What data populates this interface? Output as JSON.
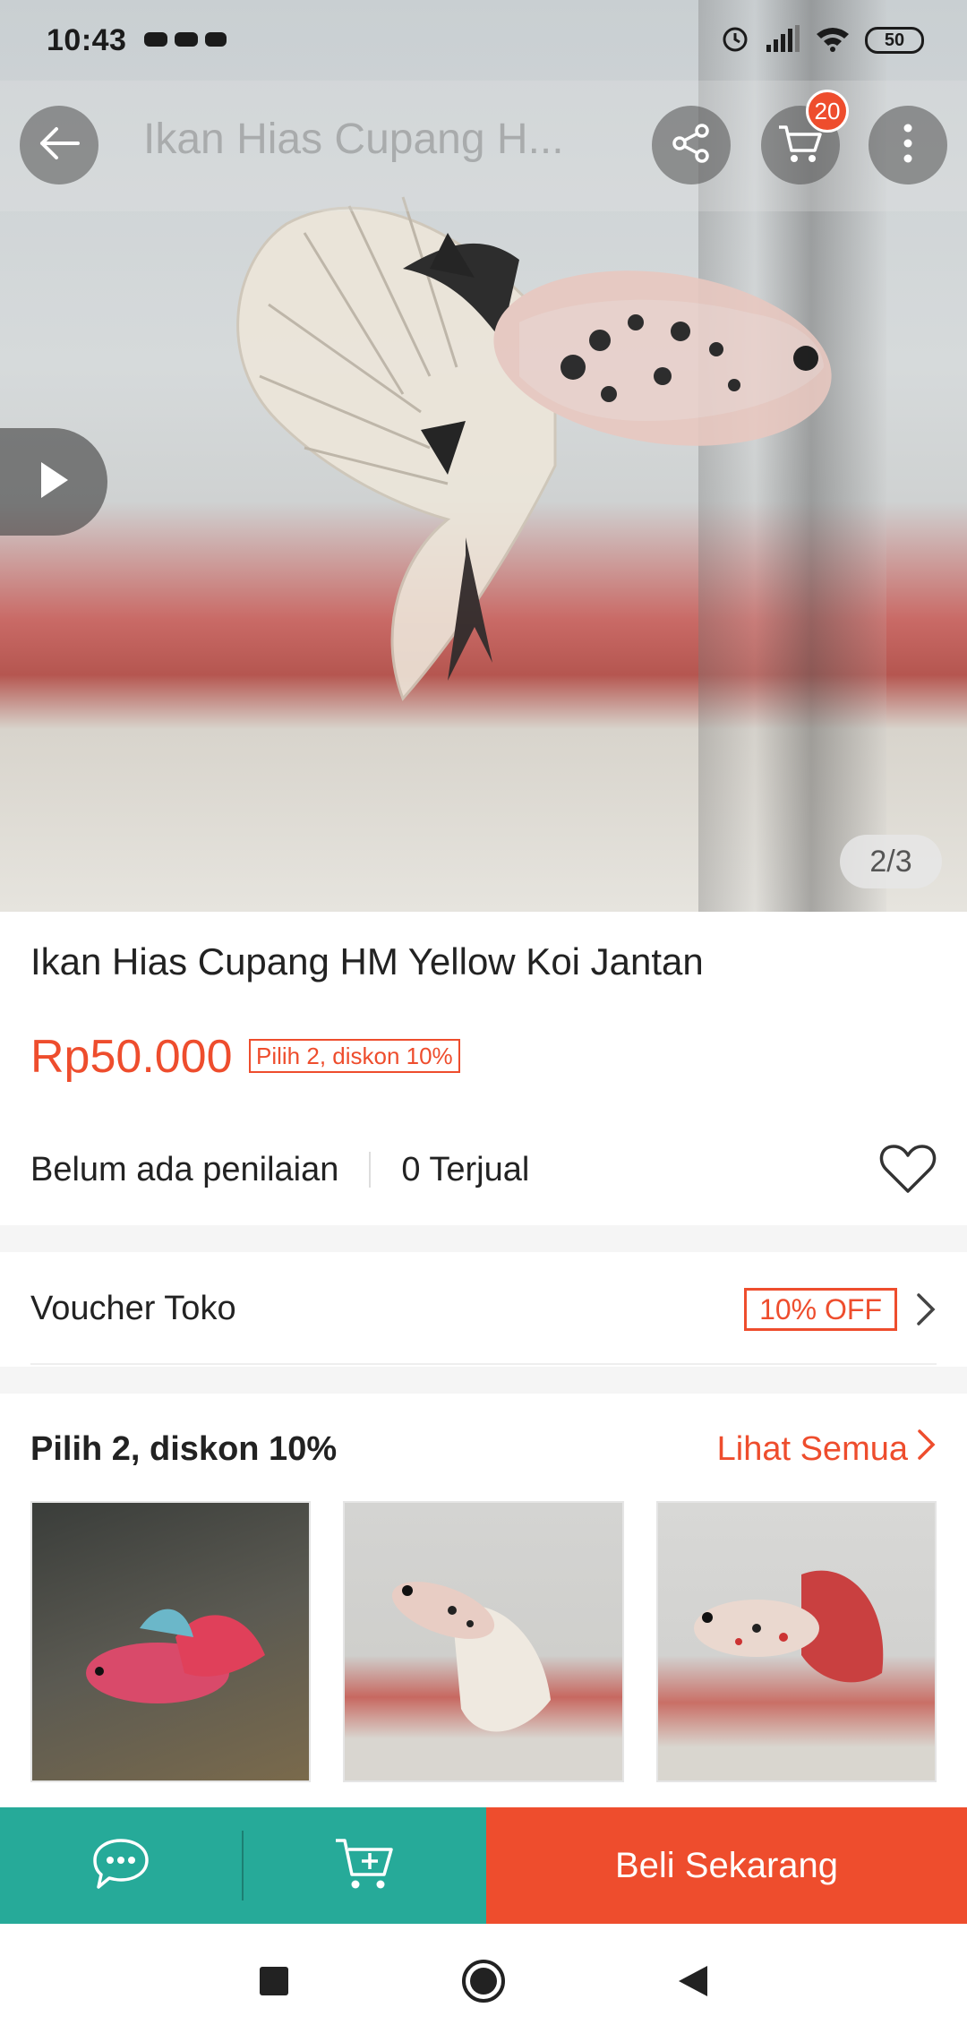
{
  "status_bar": {
    "time": "10:43",
    "battery": "50"
  },
  "nav": {
    "title": "Ikan Hias Cupang H...",
    "cart_count": "20"
  },
  "gallery": {
    "counter": "2/3"
  },
  "product": {
    "title": "Ikan Hias Cupang HM Yellow Koi Jantan",
    "price": "Rp50.000",
    "promo_tag": "Pilih 2, diskon 10%",
    "rating_text": "Belum ada penilaian",
    "sold_text": "0 Terjual"
  },
  "voucher": {
    "label": "Voucher Toko",
    "badge": "10% OFF"
  },
  "bundle": {
    "title": "Pilih 2, diskon 10%",
    "see_all": "Lihat Semua"
  },
  "actions": {
    "buy_now": "Beli Sekarang"
  },
  "colors": {
    "accent": "#ee4d2d",
    "teal": "#26aa99"
  },
  "icons": [
    "back-arrow-icon",
    "share-icon",
    "cart-icon",
    "more-vertical-icon",
    "play-icon",
    "heart-icon",
    "chevron-right-icon",
    "chat-icon",
    "add-to-cart-icon",
    "recent-apps-icon",
    "home-icon",
    "back-triangle-icon"
  ]
}
